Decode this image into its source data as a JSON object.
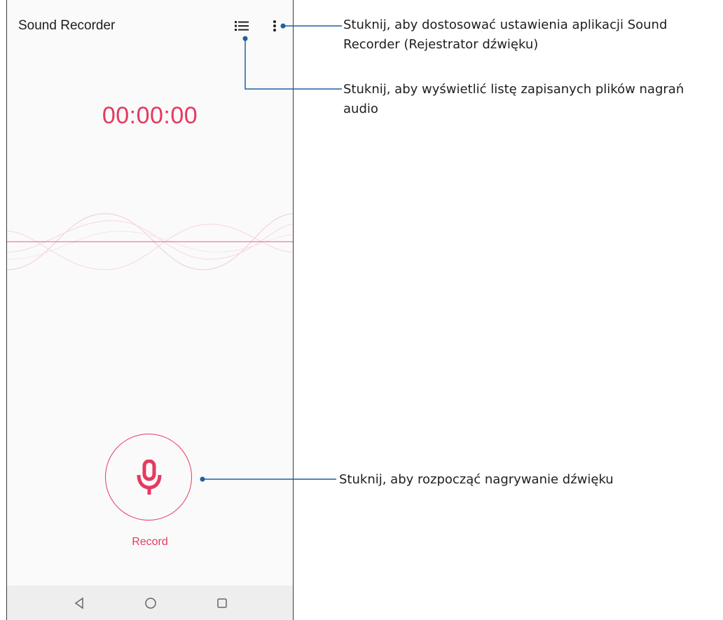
{
  "app": {
    "title": "Sound Recorder"
  },
  "toolbar": {
    "list_icon": "list-icon",
    "more_icon": "more-vertical-icon"
  },
  "recorder": {
    "timer": "00:00:00",
    "record_label": "Record",
    "mic_icon": "microphone-icon",
    "accent_color": "#e6395f"
  },
  "navbar": {
    "back_icon": "back-icon",
    "home_icon": "home-icon",
    "recent_icon": "recent-apps-icon"
  },
  "callouts": {
    "settings": [
      "Stuknij, aby dostosować ustawienia aplikacji Sound",
      "Recorder (Rejestrator dźwięku)"
    ],
    "list": [
      "Stuknij, aby wyświetlić listę zapisanych plików nagrań",
      "audio"
    ],
    "record": [
      "Stuknij, aby rozpocząć nagrywanie dźwięku"
    ],
    "line_color": "#1f5fa0"
  }
}
